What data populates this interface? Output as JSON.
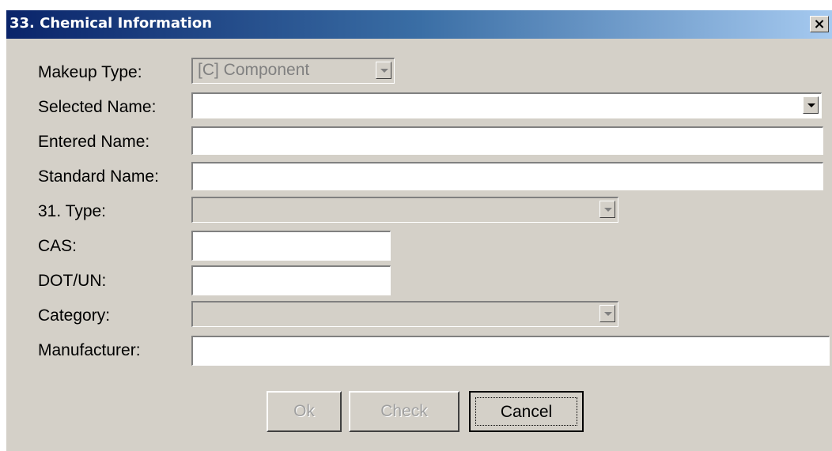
{
  "window": {
    "title": "33. Chemical Information",
    "close_glyph": "×"
  },
  "fields": {
    "makeup_type": {
      "label": "Makeup Type:",
      "value": "[C] Component"
    },
    "selected_name": {
      "label": "Selected Name:",
      "value": ""
    },
    "entered_name": {
      "label": "Entered Name:",
      "value": ""
    },
    "standard_name": {
      "label": "Standard Name:",
      "value": ""
    },
    "type": {
      "label": "31. Type:",
      "value": ""
    },
    "cas": {
      "label": "CAS:",
      "value": ""
    },
    "dot_un": {
      "label": "DOT/UN:",
      "value": ""
    },
    "category": {
      "label": "Category:",
      "value": ""
    },
    "manufacturer": {
      "label": "Manufacturer:",
      "value": ""
    }
  },
  "buttons": {
    "ok": {
      "label": "Ok",
      "enabled": false
    },
    "check": {
      "label": "Check",
      "enabled": false
    },
    "cancel": {
      "label": "Cancel",
      "enabled": true
    }
  },
  "icons": {
    "dropdown_arrow": "chevron-down-icon",
    "close": "close-icon"
  },
  "colors": {
    "title_start": "#0a246a",
    "title_end": "#a6caf0",
    "dialog_bg": "#d4d0c8"
  }
}
